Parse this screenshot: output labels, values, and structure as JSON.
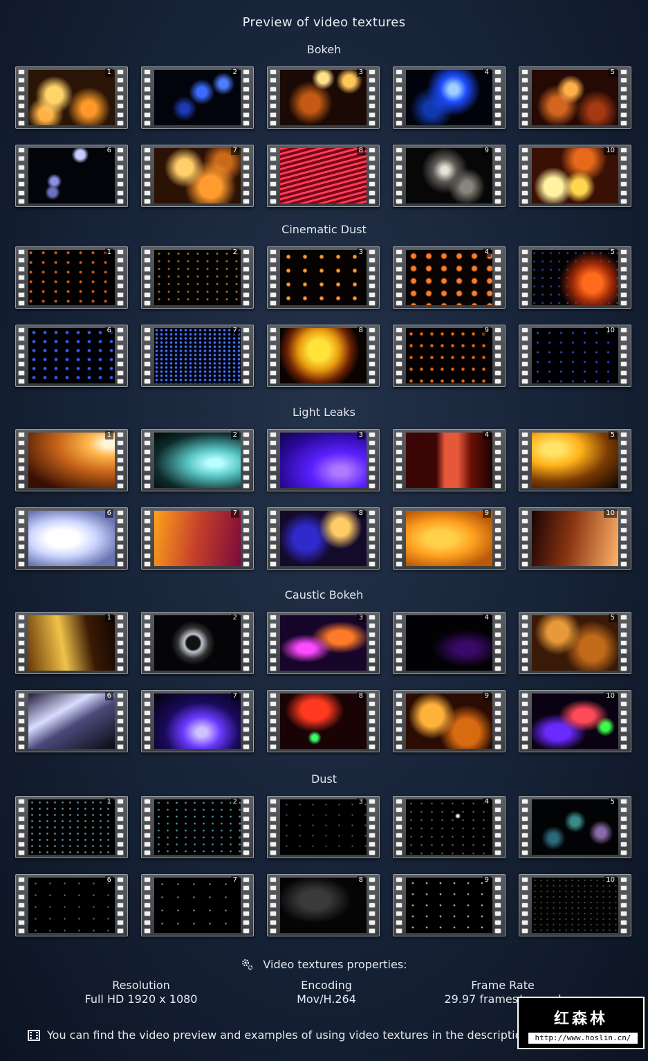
{
  "title": "Preview of video textures",
  "sections": [
    {
      "name": "Bokeh",
      "grad": [
        "radial-gradient(circle at 30% 45%, #ffd36a 0 12%, transparent 28%), radial-gradient(circle at 70% 70%, #ff9a2a 0 10%, transparent 30%), radial-gradient(circle at 20% 80%, #ffb347 0 8%, transparent 22%), #2a1406",
        "radial-gradient(circle at 55% 40%, #3a6cff 0 8%, transparent 22%), radial-gradient(circle at 35% 70%, #1d3bb5 0 6%, transparent 18%), radial-gradient(circle at 80% 25%, #4f7dff 0 5%, transparent 14%), #02040d",
        "radial-gradient(circle at 50% 15%, #ffe08a 0 8%, transparent 18%), radial-gradient(circle at 80% 20%, #ffc75a 0 7%, transparent 16%), radial-gradient(circle at 35% 60%, #c45a14 0 14%, transparent 34%), #1a0904",
        "radial-gradient(circle at 55% 35%, #9fd0ff 0 8%, #1c4cff 22%, transparent 45%), radial-gradient(circle at 30% 70%, #123ab0 0 10%, transparent 30%), #01030c",
        "radial-gradient(circle at 45% 35%, #ffb04a 0 10%, transparent 24%), radial-gradient(circle at 30% 65%, #d2651f 0 12%, transparent 30%), radial-gradient(circle at 75% 75%, #a43a12 0 10%, transparent 28%), #240905",
        "radial-gradient(circle at 60% 12%, #c9ccff 0 6%, transparent 12%), radial-gradient(circle at 30% 60%, #8e8fe6 0 5%, transparent 11%), radial-gradient(circle at 28% 80%, #6d6fc0 0 5%, transparent 10%), #03030a",
        "radial-gradient(circle at 35% 35%, #ffcf6a 0 12%, transparent 30%), radial-gradient(circle at 65% 70%, #ff9b2f 0 16%, transparent 38%), radial-gradient(circle at 80% 25%, #c96a1b 0 10%, transparent 26%), #2b1205",
        "repeating-linear-gradient(165deg, #ff3d5a 0 3px, #7a0717 3px 7px), #200207",
        "radial-gradient(circle at 45% 40%, #e6e2d8 0 6%, #5d5a55 20%, transparent 40%), radial-gradient(circle at 70% 70%, #8a857c 0 8%, transparent 26%), #070707",
        "radial-gradient(circle at 25% 70%, #fff2a0 0 12%, transparent 26%), radial-gradient(circle at 55% 70%, #ffd64e 0 12%, transparent 26%), radial-gradient(circle at 60% 20%, #e76a1c 0 14%, transparent 34%), #3a1005"
      ]
    },
    {
      "name": "Cinematic Dust",
      "grad": [
        "radial-gradient(circle at 20% 30%, #d25a20 0 1.5px, transparent 2.5px) 0 0/18px 14px, #020100",
        "radial-gradient(circle at 50% 50%, #a8701c 0 1px, transparent 2px) 0 0/14px 11px, #010101",
        "radial-gradient(circle at 50% 50%, #ff9a2a 0 2px, transparent 3.5px) 0 0/24px 20px, #050201",
        "radial-gradient(circle at 50% 50%, #ff7d2a 0 3px, transparent 5px) 0 0/22px 18px, #080301",
        "radial-gradient(circle at 70% 60%, #ff6a1c 0 14%, #a02a08 28%, transparent 48%), radial-gradient(circle at 30% 40%, #2a3b8a 0 1px, transparent 2px) 0 0/12px 12px, #020104",
        "radial-gradient(circle at 50% 50%, #3d5eff 0 1.5px, transparent 3px) 0 0/16px 13px, #000105",
        "radial-gradient(circle at 50% 50%, #4a78ff 0 1.2px, transparent 2.2px) 0 0/7px 6px, #000312",
        "radial-gradient(circle at 45% 40%, #ffe23a 0 18%, #e89a10 35%, #6a2004 55%, transparent 70%), #0a0300",
        "radial-gradient(circle at 50% 50%, #e0681a 0 1.5px, transparent 3px) 0 0/15px 17px, #040100",
        "radial-gradient(circle at 50% 50%, #2f4cc8 0 1px, transparent 2px) 0 0/17px 14px, #000004"
      ]
    },
    {
      "name": "Light Leaks",
      "grad": [
        "radial-gradient(ellipse at 95% 20%, #fff6d8 0 6%, #ffb54a 20%, #c9661a 45%, #3a0f03 85%)",
        "radial-gradient(ellipse at 70% 55%, #b9ffff 0 8%, #5cc9c9 30%, #0d2a2a 70%, #020606)",
        "radial-gradient(ellipse at 70% 70%, #b07aff 0 8%, #5a1fff 35%, #2a0a9a 70%, #12044a)",
        "linear-gradient(90deg, #3a0504 0 35%, #e5583a 45% 60%, #6a1006 75%, #1a0201)",
        "radial-gradient(ellipse at 25% 30%, #ffe46a 0 10%, #ffb21a 30%, #7a3a04 60%, #0c0400)",
        "radial-gradient(ellipse at 40% 50%, #ffffff 0 22%, #cdd6ff 45%, #6a74b0 80%)",
        "linear-gradient(100deg, #ffa21c 0%, #c43f2a 50%, #7a0a3a 100%)",
        "radial-gradient(circle at 70% 30%, #ffcc66 0 12%, transparent 30%), radial-gradient(circle at 30% 50%, #2f2acc 0 18%, transparent 40%), #140a2a",
        "radial-gradient(ellipse at 40% 50%, #ffd04a 0 20%, #ffa020 45%, #b85a08 80%)",
        "linear-gradient(100deg, #1a0402 0%, #8a3412 45%, #ffb46a 100%)"
      ]
    },
    {
      "name": "Caustic Bokeh",
      "grad": [
        "linear-gradient(80deg, #6a3a08 0%, #f0c24a 40%, #3a1a04 70%, #120602)",
        "radial-gradient(circle at 45% 50%, #111 0 12%, #c0c4d0 16%, #333 28%, transparent 40%), #050508",
        "radial-gradient(ellipse at 30% 60%, #ff4aff 0 10%, transparent 30%), radial-gradient(ellipse at 70% 40%, #ff7a2a 0 14%, transparent 34%), #18052a",
        "radial-gradient(ellipse at 70% 60%, #3a0a6a 0 12%, transparent 40%), #020104",
        "radial-gradient(circle at 30% 30%, #e89a3a 0 14%, transparent 32%), radial-gradient(circle at 70% 60%, #c06a1a 0 18%, transparent 40%), #3a1a06",
        "linear-gradient(150deg, #221c3a 0%, #d8dcff 35%, #4a4a7a 55%, #0a0a14 100%)",
        "radial-gradient(ellipse at 55% 70%, #d0c0ff 0 8%, #6a3aff 28%, #1a0a5a 55%, #020108)",
        "radial-gradient(ellipse at 40% 30%, #ff3a20 0 18%, transparent 40%), radial-gradient(circle at 40% 80%, #3aff6a 0 4%, transparent 10%), #1a0304",
        "radial-gradient(circle at 30% 40%, #ffb23a 0 16%, transparent 34%), radial-gradient(circle at 70% 70%, #d86a12 0 18%, transparent 38%), #2a0c02",
        "radial-gradient(ellipse at 60% 40%, #ff4a5a 0 14%, transparent 34%), radial-gradient(ellipse at 30% 70%, #6a2aff 0 14%, transparent 34%), radial-gradient(circle at 85% 60%, #3aff4a 0 5%, transparent 12%), #0a0212"
      ]
    },
    {
      "name": "Dust",
      "grad": [
        "radial-gradient(circle at 50% 50%, #5a8aa8 0 1px, transparent 1.8px) 0 0/11px 9px, #000",
        "radial-gradient(circle at 50% 50%, #4a90a0 0 1px, transparent 1.8px) 0 0/13px 10px, #000",
        "radial-gradient(circle at 50% 50%, #555 0 0.8px, transparent 1.5px) 0 0/19px 15px, #000",
        "radial-gradient(circle at 60% 30%, #ddd 0 2px, transparent 4px), radial-gradient(circle at 50% 50%, #666 0 0.8px, transparent 1.6px) 0 0/15px 12px, #000",
        "radial-gradient(circle at 50% 40%, #3a8a8a 0 8%, transparent 20%), radial-gradient(circle at 80% 60%, #8a6aa8 0 6%, transparent 16%), radial-gradient(circle at 25% 70%, #2a6a7a 0 6%, transparent 16%), #020304",
        "radial-gradient(circle at 50% 50%, #666 0 0.8px, transparent 1.6px) 0 0/21px 17px, #000",
        "radial-gradient(circle at 50% 50%, #888 0 0.8px, transparent 1.6px) 0 0/23px 19px, #000",
        "radial-gradient(ellipse at 40% 40%, #3a3a3a 0 20%, transparent 50%), #050505",
        "radial-gradient(circle at 50% 50%, #aaa 0 1px, transparent 1.8px) 0 0/20px 16px, #000",
        "radial-gradient(circle at 50% 50%, #444 0 0.8px, transparent 1.5px) 0 0/9px 8px, #020202"
      ]
    }
  ],
  "properties_header": "Video textures properties:",
  "properties": [
    {
      "label": "Resolution",
      "value": "Full HD 1920 x 1080"
    },
    {
      "label": "Encoding",
      "value": "Mov/H.264"
    },
    {
      "label": "Frame Rate",
      "value": "29.97 frames/second"
    }
  ],
  "footer": "You can find the video preview and examples of using video textures in the description of the product",
  "watermark": {
    "cn": "红森林",
    "url": "http://www.hoslin.cn/"
  }
}
